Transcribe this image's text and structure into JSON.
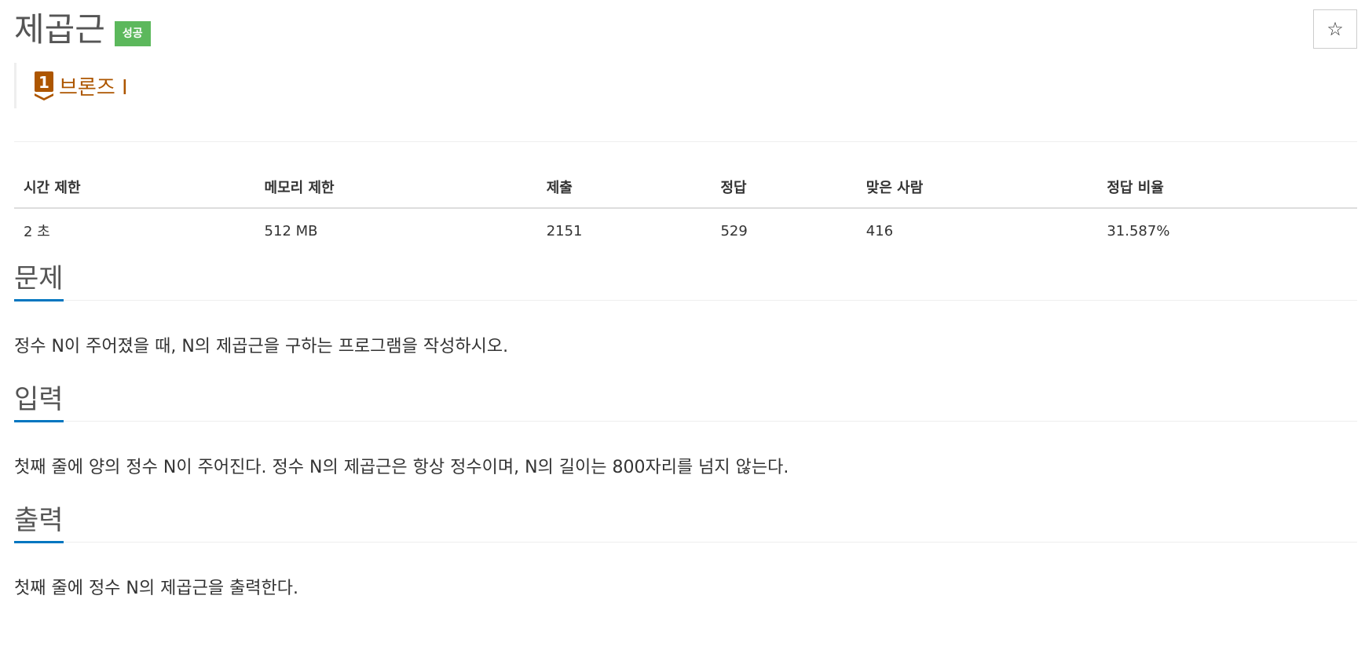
{
  "problem": {
    "title": "제곱근",
    "status_badge": "성공",
    "star_icon": "☆",
    "tier": {
      "level_number": "1",
      "label": "브론즈 I",
      "color": "#ad5600"
    }
  },
  "info_table": {
    "headers": [
      "시간 제한",
      "메모리 제한",
      "제출",
      "정답",
      "맞은 사람",
      "정답 비율"
    ],
    "values": [
      "2 초",
      "512 MB",
      "2151",
      "529",
      "416",
      "31.587%"
    ]
  },
  "sections": {
    "description": {
      "title": "문제",
      "text": "정수 N이 주어졌을 때, N의 제곱근을 구하는 프로그램을 작성하시오."
    },
    "input": {
      "title": "입력",
      "text": "첫째 줄에 양의 정수 N이 주어진다. 정수 N의 제곱근은 항상 정수이며, N의 길이는 800자리를 넘지 않는다."
    },
    "output": {
      "title": "출력",
      "text": "첫째 줄에 정수 N의 제곱근을 출력한다."
    }
  },
  "colors": {
    "success_badge": "#5cb85c",
    "section_underline": "#0076c0",
    "tier_bronze": "#ad5600"
  }
}
